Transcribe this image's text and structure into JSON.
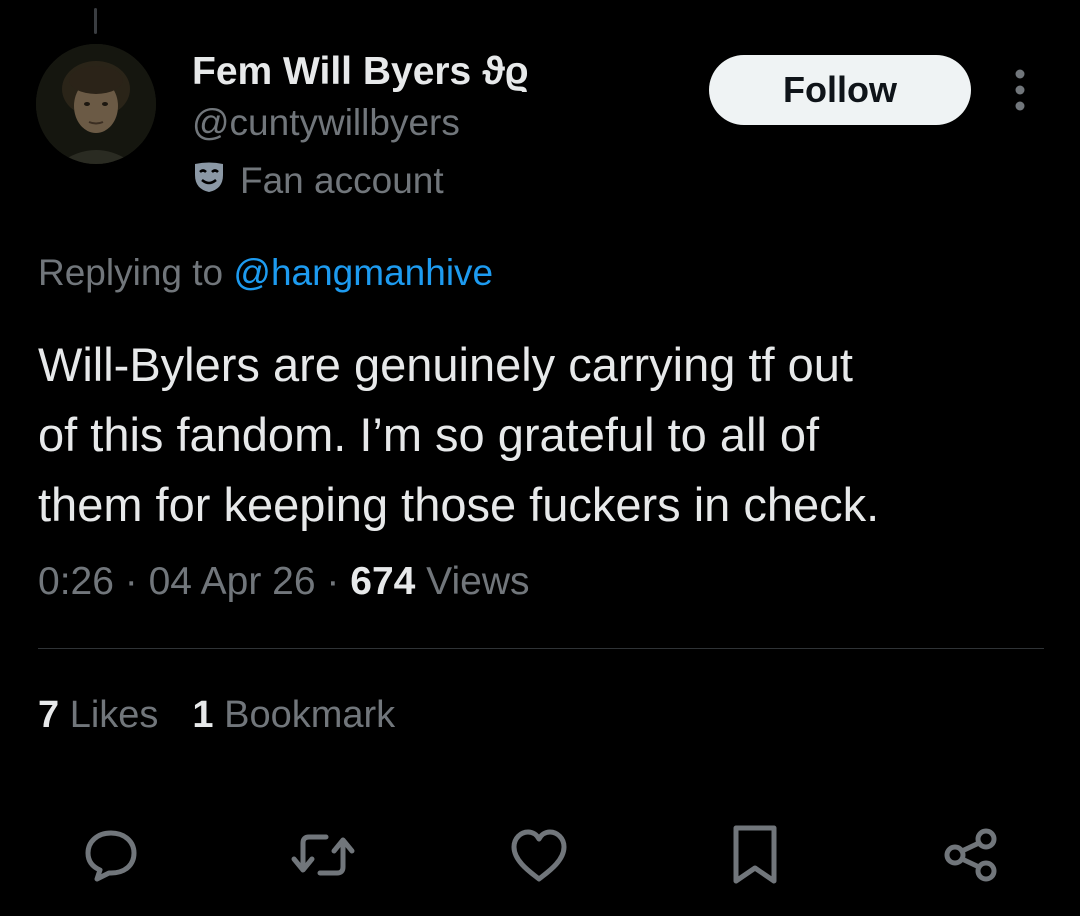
{
  "tweet": {
    "author": {
      "display_name": "Fem Will Byers ϑϱ",
      "handle": "@cuntywillbyers",
      "label": "Fan account",
      "label_icon": "theater-masks-icon"
    },
    "follow_label": "Follow",
    "replying_to_prefix": "Replying to ",
    "replying_to_handle": "@hangmanhive",
    "text": "Will-Bylers are genuinely carrying tf out\nof this fandom. I’m so grateful to all of\nthem for keeping those fuckers in check.",
    "time": "0:26",
    "separator": "·",
    "date": "04 Apr 26",
    "views_count": "674",
    "views_label": "Views",
    "likes_count": "7",
    "likes_label": "Likes",
    "bookmarks_count": "1",
    "bookmarks_label": "Bookmark"
  },
  "actions": [
    {
      "icon": "reply-icon"
    },
    {
      "icon": "retweet-icon"
    },
    {
      "icon": "like-icon"
    },
    {
      "icon": "bookmark-icon"
    },
    {
      "icon": "share-icon"
    }
  ],
  "colors": {
    "background": "#000000",
    "primary_text": "#e7e9ea",
    "secondary_text": "#71767b",
    "link": "#1d9bf0",
    "button_bg": "#eff3f4",
    "divider": "#2f3336"
  }
}
